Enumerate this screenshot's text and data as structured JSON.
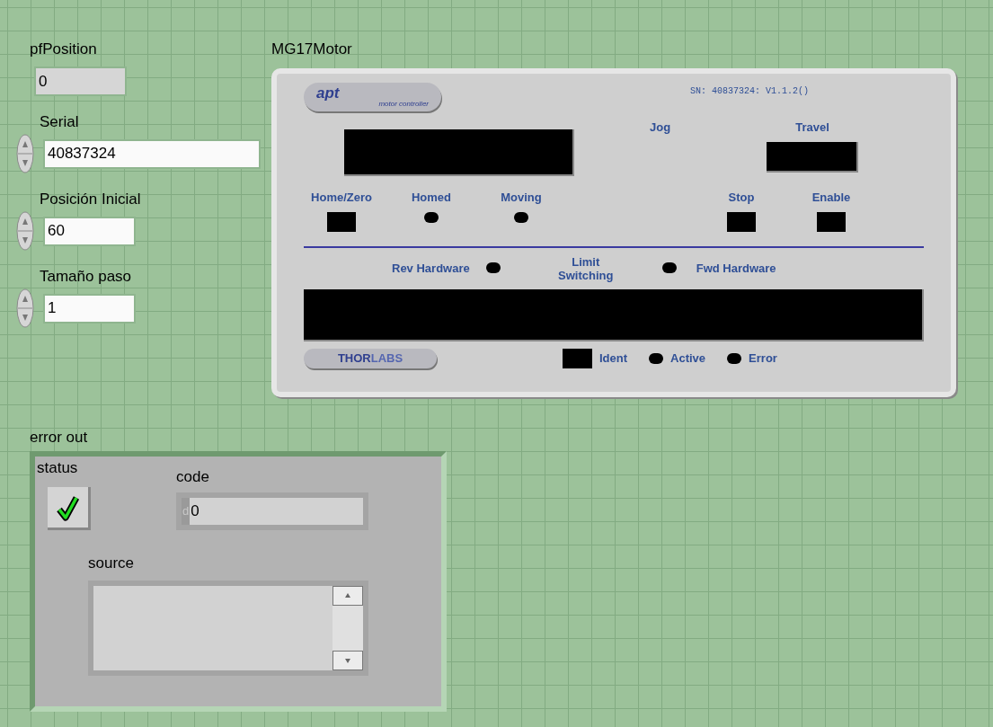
{
  "fields": [
    {
      "kind": "indicator",
      "label": "pfPosition",
      "value": "0"
    },
    {
      "kind": "control",
      "label": "Serial",
      "value": "40837324"
    },
    {
      "kind": "control",
      "label": "Posición Inicial",
      "value": "60"
    },
    {
      "kind": "control",
      "label": "Tamaño paso",
      "value": "1"
    }
  ],
  "motor": {
    "title": "MG17Motor",
    "logo": "apt",
    "logo_caption": "motor controller",
    "serial_info": "SN: 40837324: V1.1.2()",
    "jog_label": "Jog",
    "travel_label": "Travel",
    "status_row": [
      {
        "kind": "button",
        "label": "Home/Zero"
      },
      {
        "kind": "led",
        "label": "Homed",
        "on": false
      },
      {
        "kind": "led",
        "label": "Moving",
        "on": false
      },
      {
        "kind": "button",
        "label": "Stop"
      },
      {
        "kind": "button",
        "label": "Enable"
      }
    ],
    "rev_limit": {
      "label": "Rev Hardware",
      "on": false
    },
    "limit_label": "Limit Switching",
    "fwd_limit": {
      "label": "Fwd Hardware",
      "on": false
    },
    "brand_solid": "THOR",
    "brand_outline": "LABS",
    "footer": [
      {
        "kind": "button",
        "label": "Ident"
      },
      {
        "kind": "led",
        "label": "Active",
        "on": false
      },
      {
        "kind": "led",
        "label": "Error",
        "on": false
      }
    ]
  },
  "error_out": {
    "title": "error out",
    "status_label": "status",
    "status": false,
    "code_label": "code",
    "code_radix": "d",
    "code": "0",
    "source_label": "source"
  }
}
